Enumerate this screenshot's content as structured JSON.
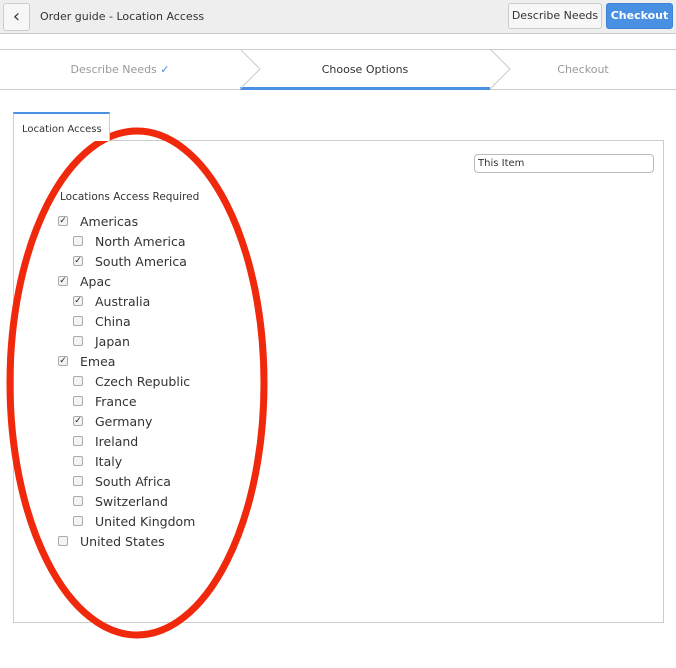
{
  "header": {
    "title": "Order guide - Location Access",
    "describe_needs": "Describe Needs",
    "checkout": "Checkout"
  },
  "stepper": [
    {
      "label": "Describe Needs",
      "check": "✓"
    },
    {
      "label": "Choose Options"
    },
    {
      "label": "Checkout"
    }
  ],
  "tab": "Location Access",
  "item_input": {
    "value": "This Item"
  },
  "field_label": "Locations Access Required",
  "options": [
    {
      "label": "Americas",
      "level": 0,
      "checked": true
    },
    {
      "label": "North America",
      "level": 1,
      "checked": false
    },
    {
      "label": "South America",
      "level": 1,
      "checked": true
    },
    {
      "label": "Apac",
      "level": 0,
      "checked": true
    },
    {
      "label": "Australia",
      "level": 1,
      "checked": true
    },
    {
      "label": "China",
      "level": 1,
      "checked": false
    },
    {
      "label": "Japan",
      "level": 1,
      "checked": false
    },
    {
      "label": "Emea",
      "level": 0,
      "checked": true
    },
    {
      "label": "Czech Republic",
      "level": 1,
      "checked": false
    },
    {
      "label": "France",
      "level": 1,
      "checked": false
    },
    {
      "label": "Germany",
      "level": 1,
      "checked": true
    },
    {
      "label": "Ireland",
      "level": 1,
      "checked": false
    },
    {
      "label": "Italy",
      "level": 1,
      "checked": false
    },
    {
      "label": "South Africa",
      "level": 1,
      "checked": false
    },
    {
      "label": "Switzerland",
      "level": 1,
      "checked": false
    },
    {
      "label": "United Kingdom",
      "level": 1,
      "checked": false
    },
    {
      "label": "United States",
      "level": 0,
      "checked": false
    }
  ],
  "annotation_color": "#f0290c"
}
